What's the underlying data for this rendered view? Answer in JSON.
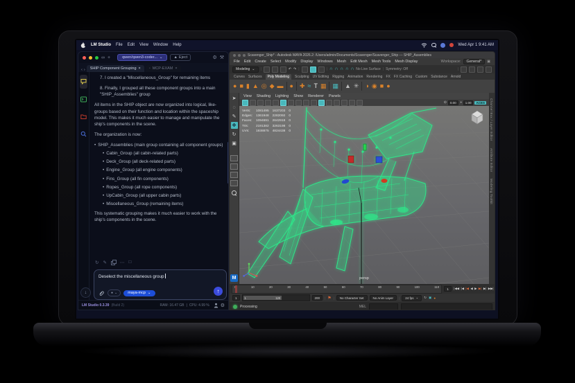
{
  "menubar": {
    "app_name": "LM Studio",
    "menus": [
      "File",
      "Edit",
      "View",
      "Window",
      "Help"
    ],
    "clock": "Wed Apr 1  9:41 AM"
  },
  "lmstudio": {
    "titlebar": {
      "model": "qwen/qwen3-coder...",
      "eject": "Eject"
    },
    "tabs": [
      "SHIP Component Grouping",
      "MCP-EXAM"
    ],
    "chat": {
      "step7": "7. I created a \"Miscellaneous_Group\" for remaining items",
      "step8": "8. Finally, I grouped all these component groups into a main \"SHIP_Assemblies\" group",
      "para1": "All items in the SHIP object are now organized into logical, like-groups based on their function and location within the spaceship model. This makes it much easier to manage and manipulate the ship's components in the scene.",
      "para2": "The organization is now:",
      "main_bullet": "SHIP_Assemblies (main group containing all component groups)",
      "groups": [
        "Cabin_Group (all cabin-related parts)",
        "Deck_Group (all deck-related parts)",
        "Engine_Group (all engine components)",
        "Fins_Group (all fin components)",
        "Ropes_Group (all rope components)",
        "UpCabin_Group (all upper cabin parts)",
        "Miscellaneous_Group (remaining items)"
      ],
      "para3": "This systematic grouping makes it much easier to work with the ship's components in the scene."
    },
    "input": {
      "value": "Deselect the miscellaneous group",
      "integration": "maya-mcp"
    },
    "statusbar": {
      "app": "LM Studio 0.3.39",
      "build": "(Build 2)",
      "ram": "RAM: 16.47 GB",
      "sep": "|",
      "cpu": "CPU: 4.99 %"
    }
  },
  "maya": {
    "title": "Scavenger_Ship* - Autodesk MAYA 2026.2:  /Users/admin/Documents/Scavenger/Scavenger_Ship  ---  SHIP_Assemblies",
    "menus": [
      "File",
      "Edit",
      "Create",
      "Select",
      "Modify",
      "Display",
      "Windows",
      "Mesh",
      "Edit Mesh",
      "Mesh Tools",
      "Mesh Display"
    ],
    "workspace_label": "Workspace:",
    "workspace": "General*",
    "menuset": "Modeling",
    "no_live_surface": "No Live Surface",
    "symmetry": "Symmetry: Off",
    "shelf_tabs": [
      "Curves",
      "Surfaces",
      "Poly Modeling",
      "Sculpting",
      "UV Editing",
      "Rigging",
      "Animation",
      "Rendering",
      "FX",
      "FX Caching",
      "Custom",
      "Substance",
      "Arnold"
    ],
    "panel_menus": [
      "View",
      "Shading",
      "Lighting",
      "Show",
      "Renderer",
      "Panels"
    ],
    "viewport": {
      "exposure": "0.00",
      "gamma": "1.00",
      "colorspace": "ACES",
      "camera": "persp"
    },
    "hud": {
      "rows": [
        {
          "label": "Verts:",
          "a": "1081495",
          "b": "1637203",
          "c": "0"
        },
        {
          "label": "Edges:",
          "a": "1361948",
          "b": "2282092",
          "c": "0"
        },
        {
          "label": "Faces:",
          "a": "1094691",
          "b": "2642918",
          "c": "0"
        },
        {
          "label": "Tris:",
          "a": "2191382",
          "b": "3263198",
          "c": "0"
        },
        {
          "label": "UVs:",
          "a": "1938875",
          "b": "4824438",
          "c": "0"
        }
      ]
    },
    "right_tabs": [
      "Channel Box / Layer Editor",
      "Attribute Editor",
      "Modeling Toolkit"
    ],
    "timeline": {
      "ticks": [
        "0",
        "10",
        "20",
        "30",
        "40",
        "50",
        "60",
        "70",
        "80",
        "90",
        "100",
        "110"
      ],
      "current": "1"
    },
    "range": {
      "anim_start": "1",
      "play_start": "1",
      "play_end": "120",
      "anim_end": "200",
      "character": "No Character Set",
      "anim_layer": "No Anim Layer",
      "fps": "24 fps"
    },
    "command": {
      "status": "Processing",
      "mel": "MEL"
    }
  },
  "colors": {
    "accent_blue": "#3b4bdc",
    "lm_pill": "#2c2f78",
    "maya_teal": "#49b8bc",
    "shelf_orange": "#d9822b",
    "ship_green": "#2ee88a"
  }
}
